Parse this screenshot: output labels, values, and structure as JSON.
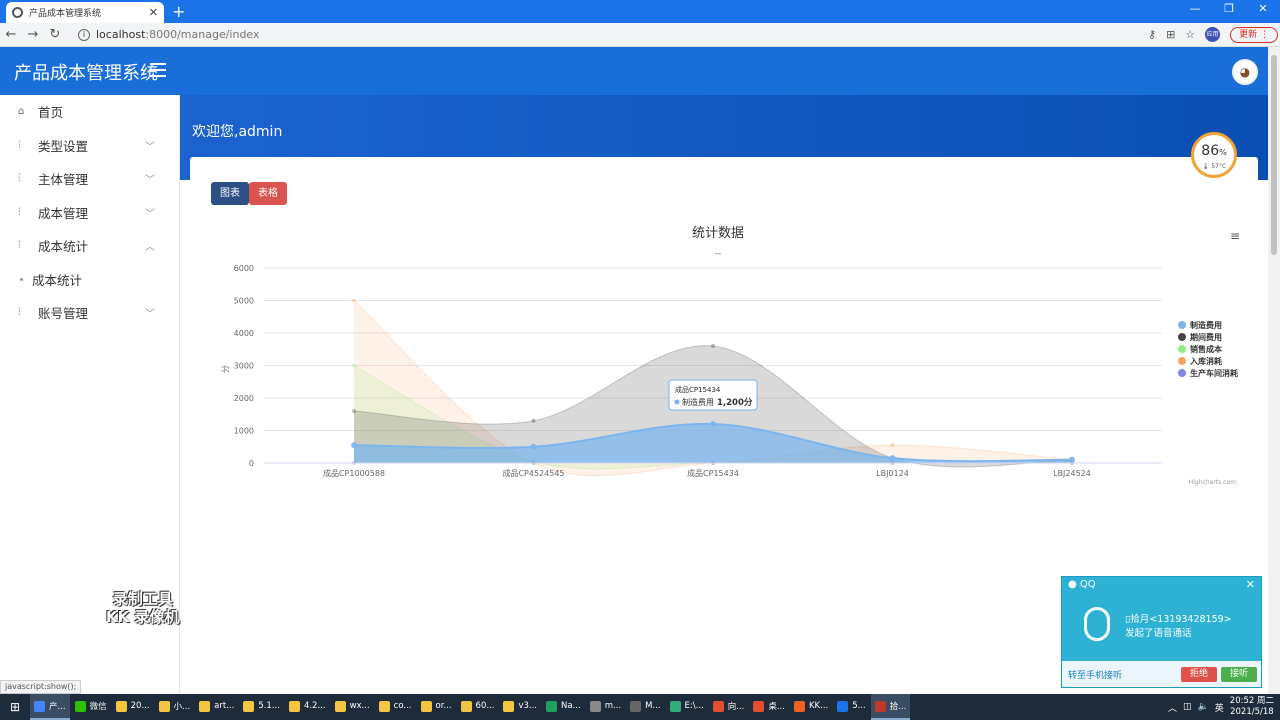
{
  "browser": {
    "tab_title": "产品成本管理系统",
    "new_tab": "+",
    "url_host": "localhost",
    "url_rest": ":8000/manage/index",
    "profile_label": "应用",
    "update_label": "更新"
  },
  "app": {
    "brand": "产品成本管理系统",
    "welcome": "欢迎您,admin"
  },
  "sidebar": {
    "items": [
      {
        "label": "首页",
        "icon": "home-icon",
        "expandable": false
      },
      {
        "label": "类型设置",
        "icon": "sliders-icon",
        "expandable": true,
        "expanded": false
      },
      {
        "label": "主体管理",
        "icon": "sliders-icon",
        "expandable": true,
        "expanded": false
      },
      {
        "label": "成本管理",
        "icon": "sliders-icon",
        "expandable": true,
        "expanded": false
      },
      {
        "label": "成本统计",
        "icon": "sliders-icon",
        "expandable": true,
        "expanded": true
      },
      {
        "label": "成本统计",
        "sub": true
      },
      {
        "label": "账号管理",
        "icon": "sliders-icon",
        "expandable": true,
        "expanded": false
      }
    ]
  },
  "buttons": {
    "chart": "图表",
    "table": "表格"
  },
  "gauge": {
    "percent": "86",
    "unit": "%",
    "temp": "57°C"
  },
  "chart_data": {
    "type": "area",
    "title": "统计数据",
    "subtitle": "--",
    "ylabel": "分",
    "ylim": [
      0,
      6000
    ],
    "yticks": [
      0,
      1000,
      2000,
      3000,
      4000,
      5000,
      6000
    ],
    "categories": [
      "成品CP1000588",
      "成品CP4524545",
      "成品CP15434",
      "LBJ0124",
      "LBJ24524"
    ],
    "series": [
      {
        "name": "制造费用",
        "color": "#7cb5ec",
        "values": [
          550,
          500,
          1200,
          150,
          100
        ]
      },
      {
        "name": "期间费用",
        "color": "#434348",
        "values": [
          1600,
          1300,
          3600,
          150,
          100
        ]
      },
      {
        "name": "销售成本",
        "color": "#90ed7d",
        "values": [
          3000,
          50,
          0,
          0,
          0
        ]
      },
      {
        "name": "入库消耗",
        "color": "#f7a35c",
        "values": [
          5000,
          0,
          0,
          550,
          100
        ]
      },
      {
        "name": "生产车间消耗",
        "color": "#8085e9",
        "values": [
          0,
          0,
          0,
          0,
          0
        ]
      }
    ],
    "tooltip": {
      "category": "成品CP15434",
      "series": "制造费用",
      "value": "1,200分"
    },
    "legend_position": "right",
    "credits": "Highcharts.com"
  },
  "status_text": "javascript:show();",
  "watermark": {
    "line1": "录制工具",
    "line2": "KK 录像机"
  },
  "qq_popup": {
    "title": "QQ",
    "caller": "拾月<13193428159>",
    "note": "发起了语音通话",
    "transfer": "转至手机接听",
    "reject": "拒绝",
    "accept": "接听"
  },
  "taskbar": {
    "items": [
      "产...",
      "微信",
      "20...",
      "小...",
      "art...",
      "5.1...",
      "4.2...",
      "wx...",
      "co...",
      "or...",
      "60...",
      "v3...",
      "Na...",
      "m...",
      "M...",
      "E:\\...",
      "向...",
      "桌...",
      "KK...",
      "5...",
      "拾..."
    ],
    "ime": "英",
    "time": "20:52 周二",
    "date": "2021/5/18"
  }
}
